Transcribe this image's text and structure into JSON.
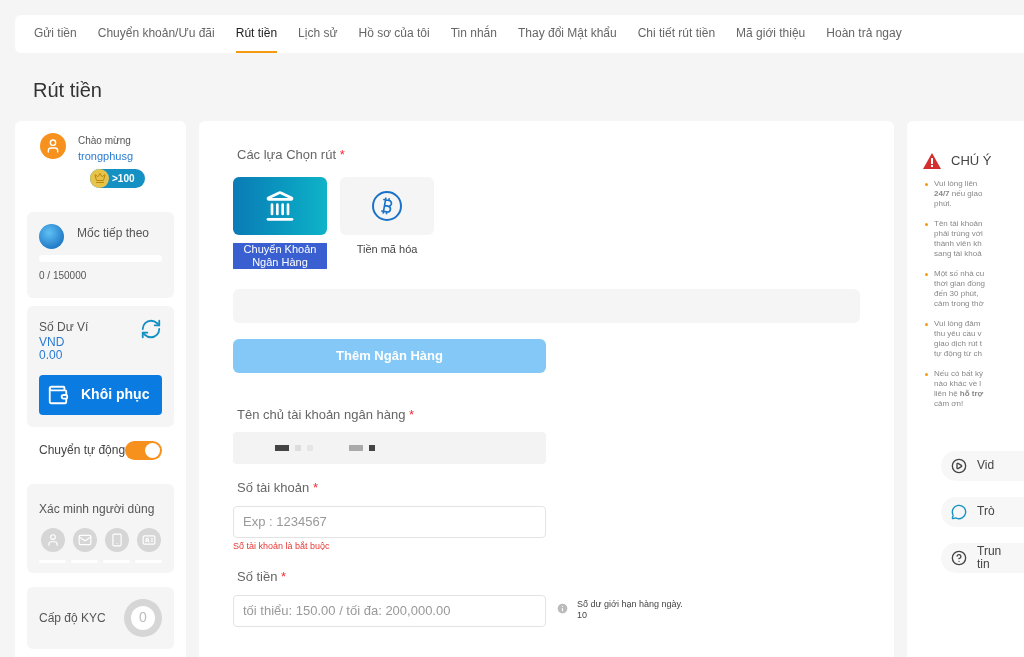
{
  "tabs": [
    {
      "label": "Gửi tiền",
      "selected": false
    },
    {
      "label": "Chuyển khoản/Ưu đãi",
      "selected": false
    },
    {
      "label": "Rút tiền",
      "selected": true
    },
    {
      "label": "Lịch sử",
      "selected": false
    },
    {
      "label": "Hồ sơ của tôi",
      "selected": false
    },
    {
      "label": "Tin nhắn",
      "selected": false
    },
    {
      "label": "Thay đổi Mật khẩu",
      "selected": false
    },
    {
      "label": "Chi tiết rút tiền",
      "selected": false
    },
    {
      "label": "Mã giới thiệu",
      "selected": false
    },
    {
      "label": "Hoàn trả ngay",
      "selected": false
    }
  ],
  "page_title": "Rút tiền",
  "sidebar": {
    "greeting": "Chào mừng",
    "username": "trongphusg",
    "vip_badge": ">100",
    "milestone": {
      "label": "Mốc tiếp theo",
      "level": 0,
      "reading": "0 / 150000"
    },
    "wallet": {
      "label": "Số Dư Ví",
      "currency": "VND",
      "amount": "0.00",
      "button": "Khôi phục"
    },
    "auto_transfer": {
      "label": "Chuyển tự động",
      "on": true
    },
    "verification": {
      "label": "Xác minh người dùng",
      "items": [
        {
          "kind": "user",
          "verified": false
        },
        {
          "kind": "email",
          "verified": false
        },
        {
          "kind": "phone",
          "verified": false
        },
        {
          "kind": "id",
          "verified": false
        }
      ]
    },
    "kyc": {
      "label": "Cấp độ KYC",
      "value": "0"
    }
  },
  "form": {
    "options_label": "Các lựa Chọn rút",
    "required_mark": "*",
    "options": [
      {
        "kind": "bank",
        "label": "Chuyển Khoản Ngân Hàng",
        "selected": true
      },
      {
        "kind": "crypto",
        "label": "Tiền mã hóa",
        "selected": false
      }
    ],
    "add_bank_button": {
      "label": "Thêm Ngân Hàng",
      "disabled": true
    },
    "fields": [
      {
        "kind": "masked",
        "label": "Tên chủ tài khoản ngân hàng",
        "required": true
      },
      {
        "kind": "text",
        "label": "Số tài khoản",
        "required": true,
        "placeholder": "Exp : 1234567",
        "error": "Số tài khoản là bắt buộc"
      },
      {
        "kind": "text",
        "label": "Số tiền",
        "required": true,
        "placeholder": "tối thiểu: 150.00 / tối đa: 200,000.00",
        "hint": [
          "Số dư giới hạn hàng ngày.",
          "10"
        ]
      }
    ]
  },
  "notice": {
    "title": "CHÚ Ý",
    "items": [
      [
        "Vui lòng liên",
        "**24/7** nếu giao",
        "phút."
      ],
      [
        "Tên tài khoản",
        "phải trùng với",
        "thành viên kh",
        "sang tài khoả"
      ],
      [
        "Một số nhà cu",
        "thời gian đồng",
        "đến 30 phút,",
        "cảm trong thờ"
      ],
      [
        "Vui lòng đảm",
        "thu yêu cầu v",
        "giao dịch rút t",
        "tự động từ ch"
      ],
      [
        "Nếu có bất kỳ",
        "nào khác về l",
        "liên hệ **hỗ trợ**",
        "cảm ơn!"
      ]
    ],
    "links": [
      {
        "kind": "video",
        "label": [
          "Vid"
        ]
      },
      {
        "kind": "chat",
        "label": [
          "Trò"
        ]
      },
      {
        "kind": "info",
        "label": [
          "Trun",
          "tin"
        ]
      }
    ]
  }
}
